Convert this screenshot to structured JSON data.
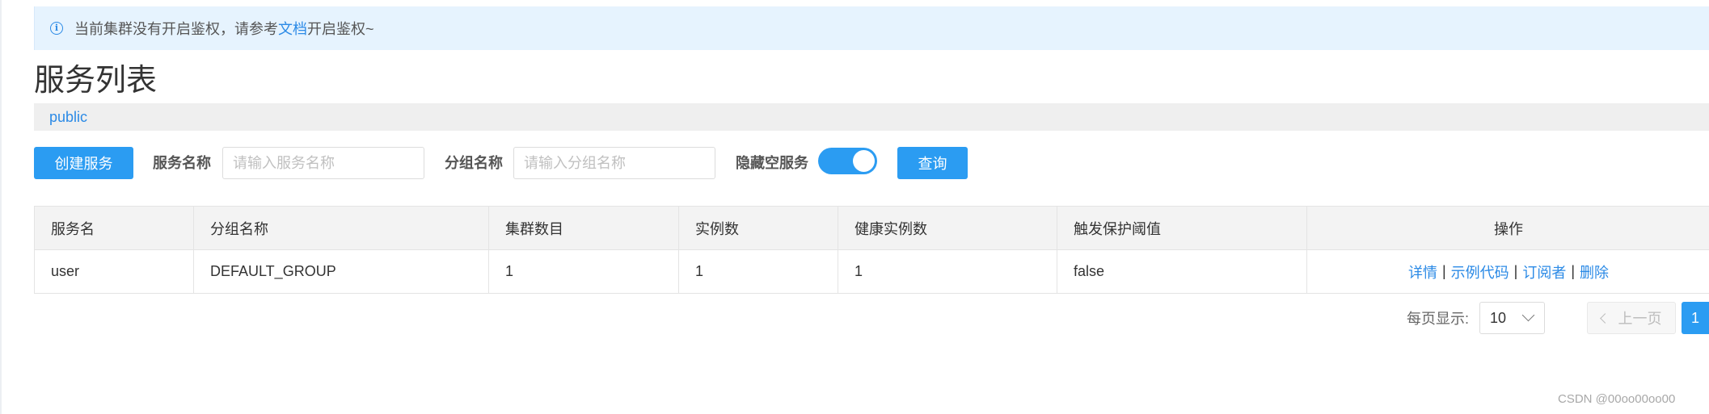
{
  "alert": {
    "icon": "info-icon",
    "message_prefix": "当前集群没有开启鉴权，请参考",
    "link_text": "文档",
    "message_suffix": "开启鉴权~"
  },
  "page_title": "服务列表",
  "namespace": "public",
  "toolbar": {
    "create_button": "创建服务",
    "service_name_label": "服务名称",
    "service_name_placeholder": "请输入服务名称",
    "group_name_label": "分组名称",
    "group_name_placeholder": "请输入分组名称",
    "hide_empty_label": "隐藏空服务",
    "hide_empty_on": true,
    "query_button": "查询"
  },
  "table": {
    "columns": [
      "服务名",
      "分组名称",
      "集群数目",
      "实例数",
      "健康实例数",
      "触发保护阈值",
      "操作"
    ],
    "rows": [
      {
        "service": "user",
        "group": "DEFAULT_GROUP",
        "clusters": "1",
        "instances": "1",
        "healthy": "1",
        "threshold": "false",
        "actions": [
          "详情",
          "示例代码",
          "订阅者",
          "删除"
        ]
      }
    ]
  },
  "pagination": {
    "page_size_label": "每页显示:",
    "page_size": "10",
    "prev_label": "上一页",
    "current_page": "1"
  },
  "watermark": "CSDN @00oo00oo00",
  "colors": {
    "accent": "#2b9cf2",
    "link": "#2b8ae6",
    "alert_bg": "#e6f3fe"
  }
}
